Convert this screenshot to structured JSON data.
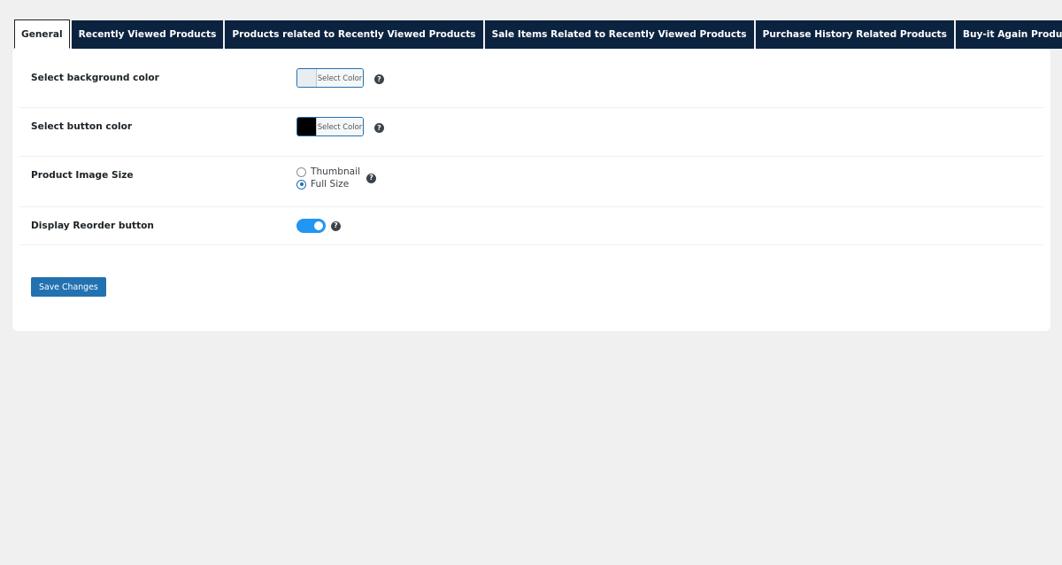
{
  "tabs": [
    {
      "label": "General",
      "active": true
    },
    {
      "label": "Recently Viewed Products",
      "active": false
    },
    {
      "label": "Products related to Recently Viewed Products",
      "active": false
    },
    {
      "label": "Sale Items Related to Recently Viewed Products",
      "active": false
    },
    {
      "label": "Purchase History Related Products",
      "active": false
    },
    {
      "label": "Buy-it Again Products",
      "active": false
    }
  ],
  "settings": {
    "background_color": {
      "label": "Select background color",
      "picker_label": "Select Color",
      "value": "#e8edf1"
    },
    "button_color": {
      "label": "Select button color",
      "picker_label": "Select Color",
      "value": "#000000"
    },
    "image_size": {
      "label": "Product Image Size",
      "options": [
        "Thumbnail",
        "Full Size"
      ],
      "selected": "Full Size"
    },
    "reorder_button": {
      "label": "Display Reorder button",
      "enabled": true
    },
    "help_glyph": "?"
  },
  "actions": {
    "save_label": "Save Changes"
  },
  "colors": {
    "tab_background": "#0c2340",
    "accent": "#2271b1",
    "toggle_on": "#2196f3",
    "page_background": "#f0f0f1"
  }
}
